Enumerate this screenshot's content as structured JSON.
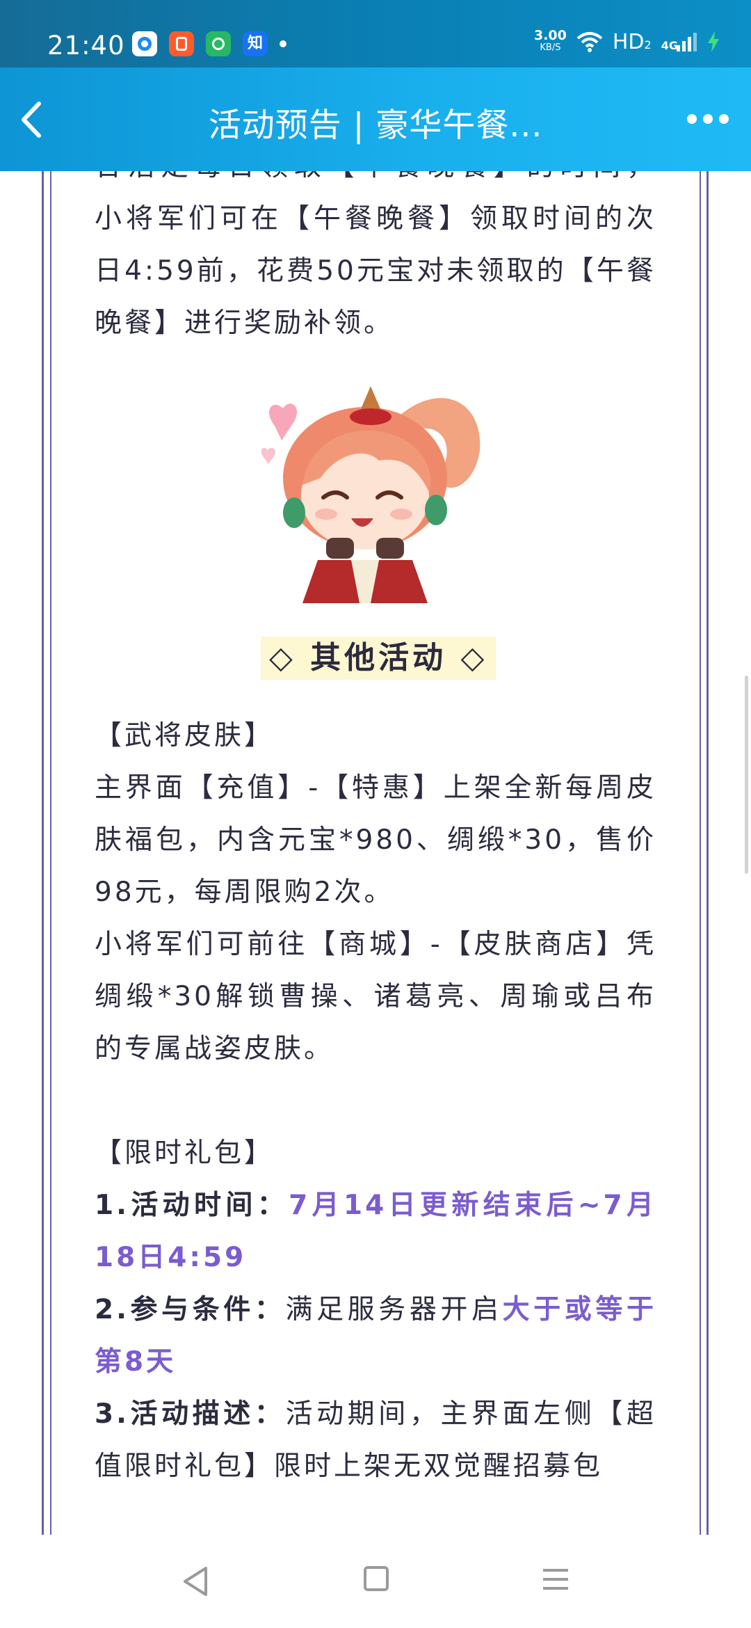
{
  "status_bar": {
    "time": "21:40",
    "net_speed_value": "3.00",
    "net_speed_unit": "KB/S",
    "hd_label": "HD",
    "hd_sub": "2",
    "network_label": "4G",
    "zhihu_label": "知"
  },
  "header": {
    "title": "活动预告 | 豪华午餐..."
  },
  "article": {
    "partial_line": "合活走每日领取【午餐晚餐】的时间，",
    "lunch_text": "小将军们可在【午餐晚餐】领取时间的次日4:59前，花费50元宝对未领取的【午餐晚餐】进行奖励补领。",
    "section_title": "◇ 其他活动 ◇",
    "skin_heading": "【武将皮肤】",
    "skin_text_1": "主界面【充值】-【特惠】上架全新每周皮肤福包，内含元宝*980、绸缎*30，售价98元，每周限购2次。",
    "skin_text_2": "小将军们可前往【商城】-【皮肤商店】凭绸缎*30解锁曹操、诸葛亮、周瑜或吕布的专属战姿皮肤。",
    "gift_heading": "【限时礼包】",
    "item1_label": "1.活动时间：",
    "item1_value": "7月14日更新结束后~7月18日4:59",
    "item2_label": "2.参与条件：",
    "item2_text": "满足服务器开启",
    "item2_value": "大于或等于第8天",
    "item3_label": "3.活动描述：",
    "item3_text": "活动期间，主界面左侧【超值限时礼包】限时上架无双觉醒招募包"
  },
  "colors": {
    "highlight": "#7b5cd0",
    "frame": "#6b5eaa",
    "header_bg": "#1ab0ee",
    "section_title_bg": "#fdf7d2"
  },
  "icons": [
    "back-arrow-icon",
    "more-dots-icon",
    "nav-back-icon",
    "nav-home-icon",
    "nav-menu-icon"
  ]
}
